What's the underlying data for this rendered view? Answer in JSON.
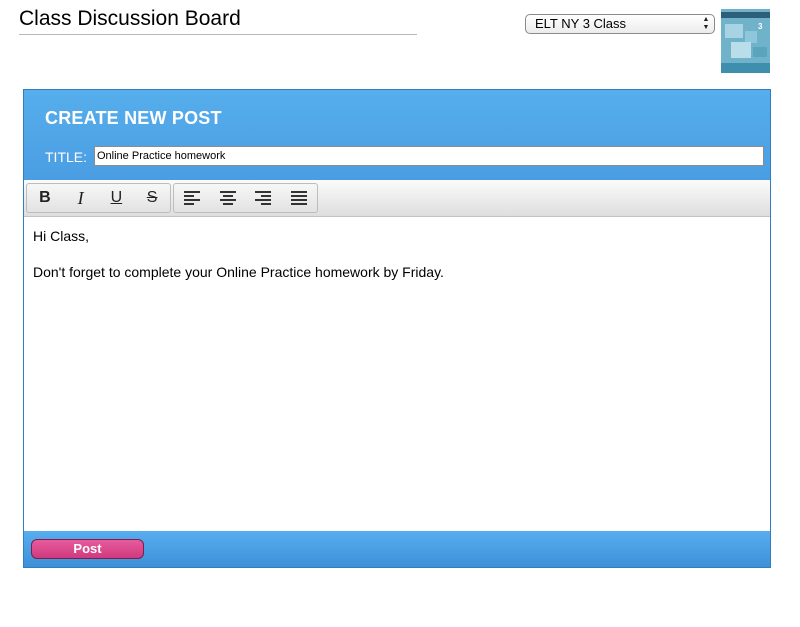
{
  "page": {
    "title": "Class Discussion Board"
  },
  "class_select": {
    "selected": "ELT NY 3 Class"
  },
  "thumbnail": {
    "label": "3"
  },
  "post_form": {
    "heading": "CREATE NEW POST",
    "title_label": "TITLE:",
    "title_value": "Online Practice homework",
    "toolbar": {
      "bold": "B",
      "italic": "I",
      "underline": "U",
      "strike": "S",
      "align_left": "align-left-icon",
      "align_center": "align-center-icon",
      "align_right": "align-right-icon",
      "align_justify": "align-justify-icon"
    },
    "body_lines": [
      "Hi Class,",
      "Don't forget to complete your Online Practice homework by Friday."
    ],
    "post_label": "Post"
  },
  "colors": {
    "panel_blue": "#4fa5ea",
    "post_pink": "#db4a8c"
  }
}
